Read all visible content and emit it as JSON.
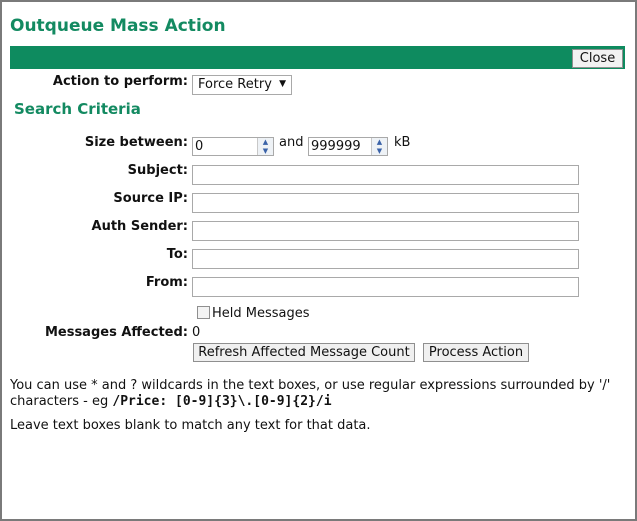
{
  "dialog": {
    "title": "Outqueue Mass Action",
    "close_label": "Close"
  },
  "action": {
    "label": "Action to perform:",
    "selected": "Force Retry"
  },
  "search": {
    "title": "Search Criteria",
    "size_label": "Size between:",
    "size_min": "0",
    "and_text": "and",
    "size_max": "999999",
    "unit": "kB",
    "subject_label": "Subject:",
    "source_ip_label": "Source IP:",
    "auth_sender_label": "Auth Sender:",
    "to_label": "To:",
    "from_label": "From:",
    "held_label": "Held Messages",
    "affected_label": "Messages Affected:",
    "affected_value": "0"
  },
  "buttons": {
    "refresh_label": "Refresh Affected Message Count",
    "process_label": "Process Action"
  },
  "notes": {
    "wildcard_text": "You can use * and ? wildcards in the text boxes, or use regular expressions surrounded by '/' characters - eg",
    "regex_example": "/Price: [0-9]{3}\\.[0-9]{2}/i",
    "blank_text": "Leave text boxes blank to match any text for that data."
  },
  "colors": {
    "accent": "#0e8b5f",
    "title_text": "#138a61"
  }
}
